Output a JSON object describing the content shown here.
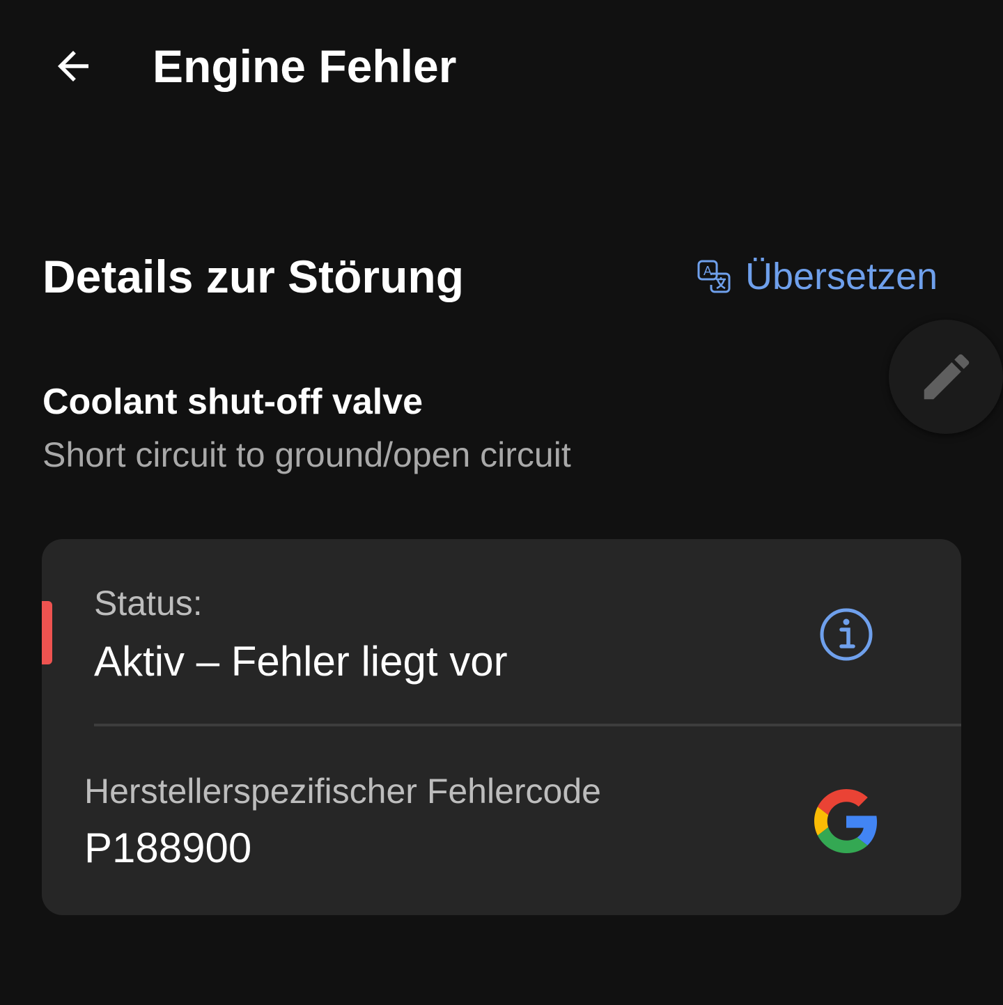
{
  "appbar": {
    "title": "Engine Fehler",
    "back_icon": "arrow-left-icon"
  },
  "details": {
    "section_title": "Details zur Störung",
    "translate_label": "Übersetzen",
    "translate_icon": "translate-icon",
    "edit_icon": "pencil-icon"
  },
  "fault": {
    "title": "Coolant shut-off valve",
    "subtitle": "Short circuit to ground/open circuit"
  },
  "card": {
    "status_label": "Status:",
    "status_value": "Aktiv – Fehler liegt vor",
    "status_icon": "info-icon",
    "code_label": "Herstellerspezifischer Fehlercode",
    "code_value": "P188900",
    "search_icon": "google-g-icon"
  },
  "colors": {
    "background": "#111111",
    "card": "#262626",
    "accent": "#6fa0ec",
    "status_active": "#ef5350",
    "secondary_text": "#a9a9a9"
  }
}
